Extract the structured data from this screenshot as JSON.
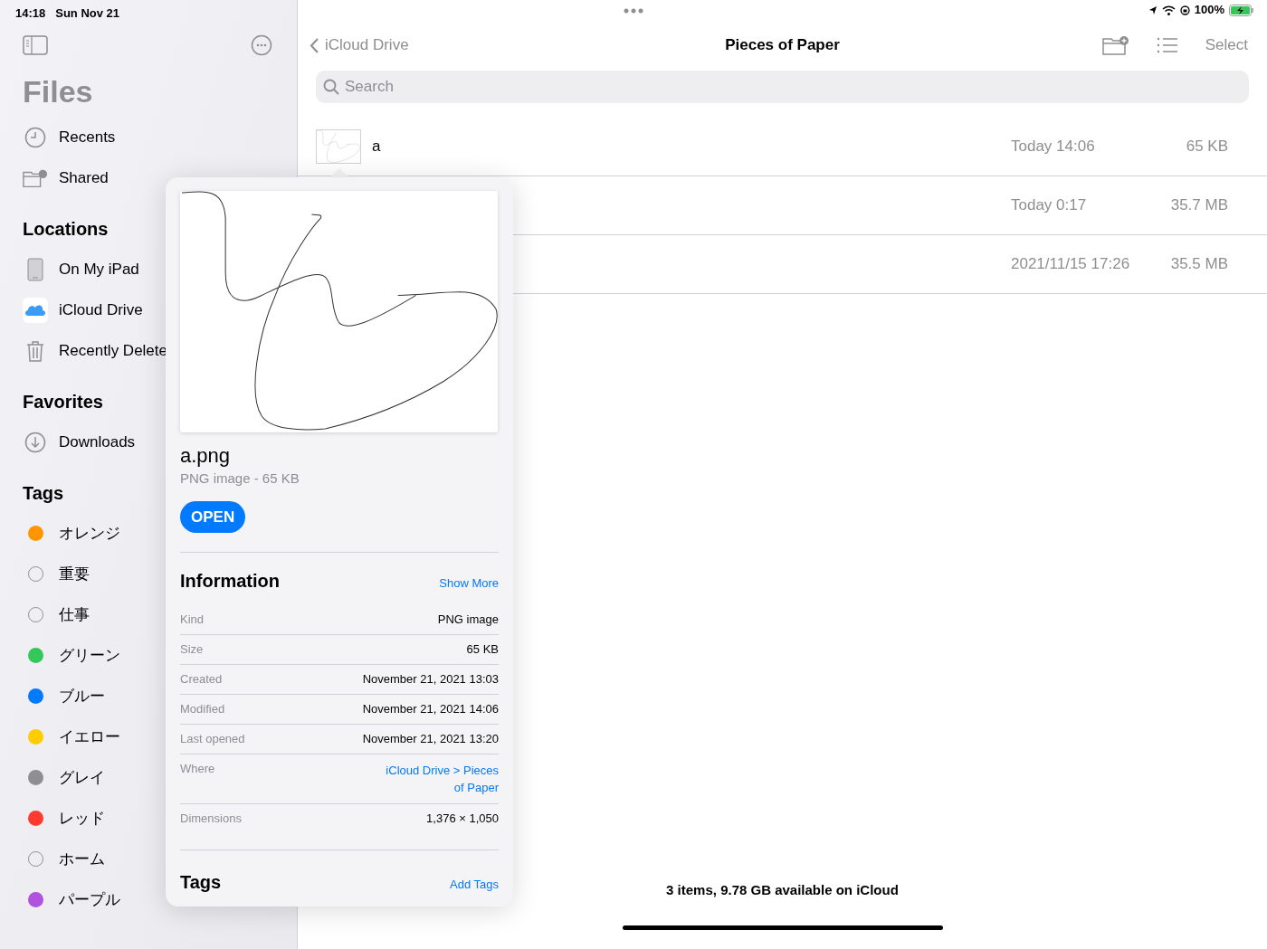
{
  "status_bar": {
    "time": "14:18",
    "date": "Sun Nov 21",
    "battery": "100%"
  },
  "sidebar": {
    "title": "Files",
    "top_items": [
      {
        "label": "Recents",
        "kind": "clock"
      },
      {
        "label": "Shared",
        "kind": "shared"
      }
    ],
    "sections": [
      {
        "title": "Locations",
        "items": [
          {
            "label": "On My iPad",
            "kind": "ipad"
          },
          {
            "label": "iCloud Drive",
            "kind": "cloud"
          },
          {
            "label": "Recently Delete",
            "kind": "trash"
          }
        ]
      },
      {
        "title": "Favorites",
        "items": [
          {
            "label": "Downloads",
            "kind": "download"
          }
        ]
      }
    ],
    "tags_title": "Tags",
    "tags": [
      {
        "label": "オレンジ",
        "color": "#ff9500"
      },
      {
        "label": "重要"
      },
      {
        "label": "仕事"
      },
      {
        "label": "グリーン",
        "color": "#34c759"
      },
      {
        "label": "ブルー",
        "color": "#007aff"
      },
      {
        "label": "イエロー",
        "color": "#ffcc00"
      },
      {
        "label": "グレイ",
        "color": "#8e8e93"
      },
      {
        "label": "レッド",
        "color": "#ff3b30"
      },
      {
        "label": "ホーム"
      },
      {
        "label": "パープル",
        "color": "#af52de"
      }
    ]
  },
  "nav": {
    "back": "iCloud Drive",
    "title": "Pieces of Paper",
    "select": "Select"
  },
  "search": {
    "placeholder": "Search"
  },
  "files": [
    {
      "name": "a",
      "date": "Today 14:06",
      "size": "65 KB"
    },
    {
      "date": "Today 0:17",
      "size": "35.7 MB"
    },
    {
      "date": "2021/11/15 17:26",
      "size": "35.5 MB"
    }
  ],
  "footer": "3 items, 9.78 GB available on iCloud",
  "popover": {
    "file_name": "a.png",
    "subtitle": "PNG image - 65 KB",
    "open_button": "OPEN",
    "info_title": "Information",
    "show_more": "Show More",
    "info": [
      {
        "label": "Kind",
        "value": "PNG image"
      },
      {
        "label": "Size",
        "value": "65 KB"
      },
      {
        "label": "Created",
        "value": "November 21, 2021 13:03"
      },
      {
        "label": "Modified",
        "value": "November 21, 2021 14:06"
      },
      {
        "label": "Last opened",
        "value": "November 21, 2021 13:20"
      },
      {
        "label": "Where",
        "value": "iCloud Drive > Pieces of Paper",
        "kind": "link"
      },
      {
        "label": "Dimensions",
        "value": "1,376 × 1,050"
      }
    ],
    "tags_title": "Tags",
    "add_tags": "Add Tags"
  }
}
